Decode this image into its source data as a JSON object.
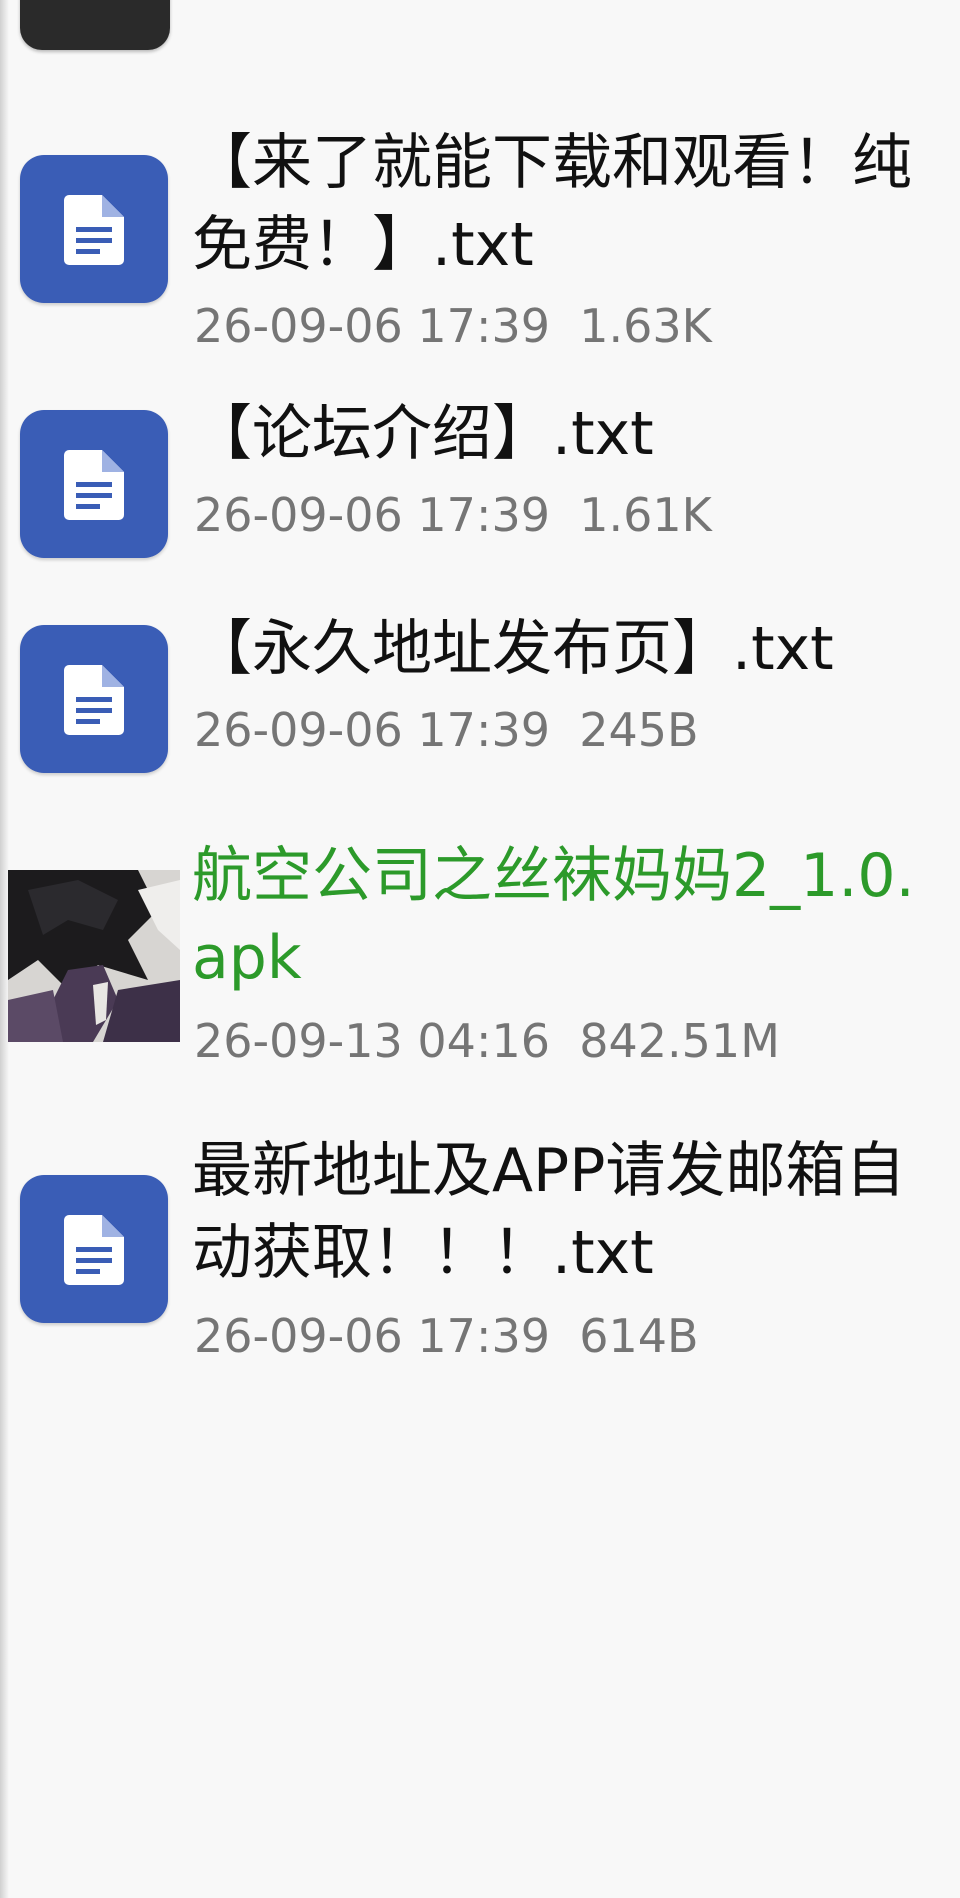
{
  "files": [
    {
      "name": "【来了就能下载和观看！纯免费！】.txt",
      "date": "26-09-06 17:39",
      "size": "1.63K",
      "icon": "document-icon"
    },
    {
      "name": "【论坛介绍】.txt",
      "date": "26-09-06 17:39",
      "size": "1.61K",
      "icon": "document-icon"
    },
    {
      "name": "【永久地址发布页】.txt",
      "date": "26-09-06 17:39",
      "size": "245B",
      "icon": "document-icon"
    },
    {
      "name": "航空公司之丝袜妈妈2_1.0.apk",
      "date": "26-09-13 04:16",
      "size": "842.51M",
      "icon": "app-thumbnail",
      "name_color": "#2c9a2a"
    },
    {
      "name": "最新地址及APP请发邮箱自动获取！！！.txt",
      "date": "26-09-06 17:39",
      "size": "614B",
      "icon": "document-icon"
    }
  ],
  "colors": {
    "doc_icon_bg": "#3a5db6",
    "apk_name": "#2c9a2a",
    "meta_text": "#757575",
    "background": "#f8f8f8"
  }
}
